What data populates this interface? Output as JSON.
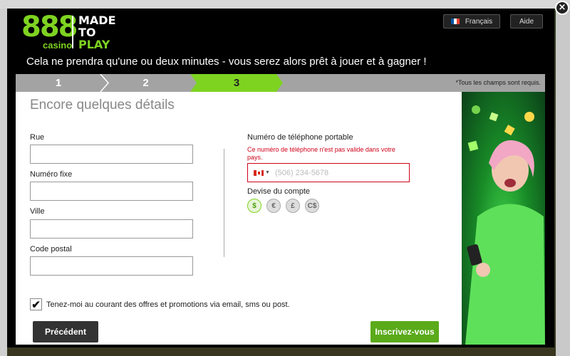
{
  "header": {
    "logo_number": "888",
    "logo_sub": "casino",
    "slogan_line1": "MADE",
    "slogan_line2": "TO",
    "slogan_line3": "PLAY",
    "language_label": "Français",
    "help_label": "Aide",
    "tagline": "Cela ne prendra qu'une ou deux minutes - vous serez alors prêt à jouer et à gagner !",
    "close_symbol": "×"
  },
  "steps": {
    "items": [
      "1",
      "2",
      "3"
    ],
    "active": "3",
    "required_note": "*Tous les champs sont requis."
  },
  "form": {
    "title": "Encore quelques détails",
    "street_label": "Rue",
    "landline_label": "Numéro fixe",
    "city_label": "Ville",
    "postal_label": "Code postal",
    "mobile_label": "Numéro de téléphone portable",
    "mobile_error": "Ce numéro de téléphone n'est pas valide dans votre pays.",
    "mobile_placeholder": "(506) 234-5678",
    "currency_label": "Devise du compte",
    "currencies": [
      "$",
      "€",
      "£",
      "C$"
    ],
    "selected_currency": "$",
    "newsletter_label": "Tenez-moi au courant des offres et promotions via email, sms ou post.",
    "newsletter_checked": true,
    "previous_button": "Précédent",
    "signup_button": "Inscrivez-vous"
  },
  "colors": {
    "brand_green": "#7ed321",
    "button_green": "#5aaa1a",
    "error_red": "#d0021b"
  }
}
